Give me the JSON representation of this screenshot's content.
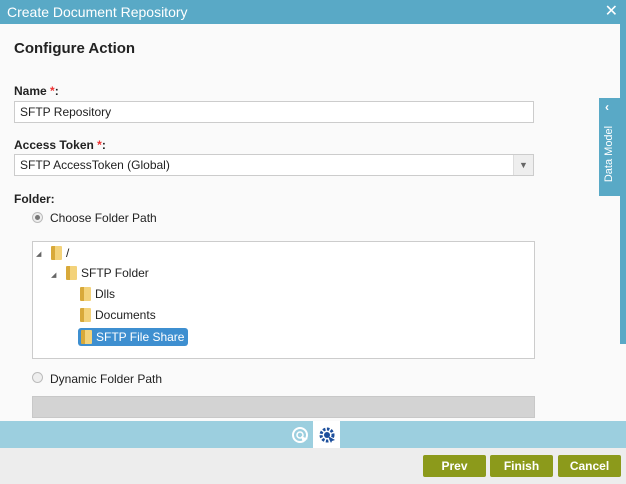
{
  "window": {
    "title": "Create Document Repository"
  },
  "heading": "Configure Action",
  "name_field": {
    "label": "Name",
    "required": "*",
    "colon": ":",
    "value": "SFTP Repository"
  },
  "token_field": {
    "label": "Access Token",
    "required": "*",
    "colon": ":",
    "value": "SFTP AccessToken (Global)"
  },
  "folder": {
    "label": "Folder",
    "colon": ":",
    "options": [
      {
        "label": "Choose Folder Path",
        "selected": true
      },
      {
        "label": "Dynamic Folder Path",
        "selected": false
      }
    ],
    "tree": [
      {
        "label": "/",
        "level": 0,
        "expanded": true
      },
      {
        "label": "SFTP Folder",
        "level": 1,
        "expanded": true
      },
      {
        "label": "Dlls",
        "level": 2
      },
      {
        "label": "Documents",
        "level": 2
      },
      {
        "label": "SFTP File Share",
        "level": 2,
        "selected": true
      }
    ],
    "dynamic_value": ""
  },
  "side_panel": {
    "label": "Data Model"
  },
  "buttons": {
    "prev": "Prev",
    "finish": "Finish",
    "cancel": "Cancel"
  },
  "colors": {
    "header": "#59a9c6",
    "button": "#8c9a1b",
    "selection": "#3e8fd0"
  }
}
